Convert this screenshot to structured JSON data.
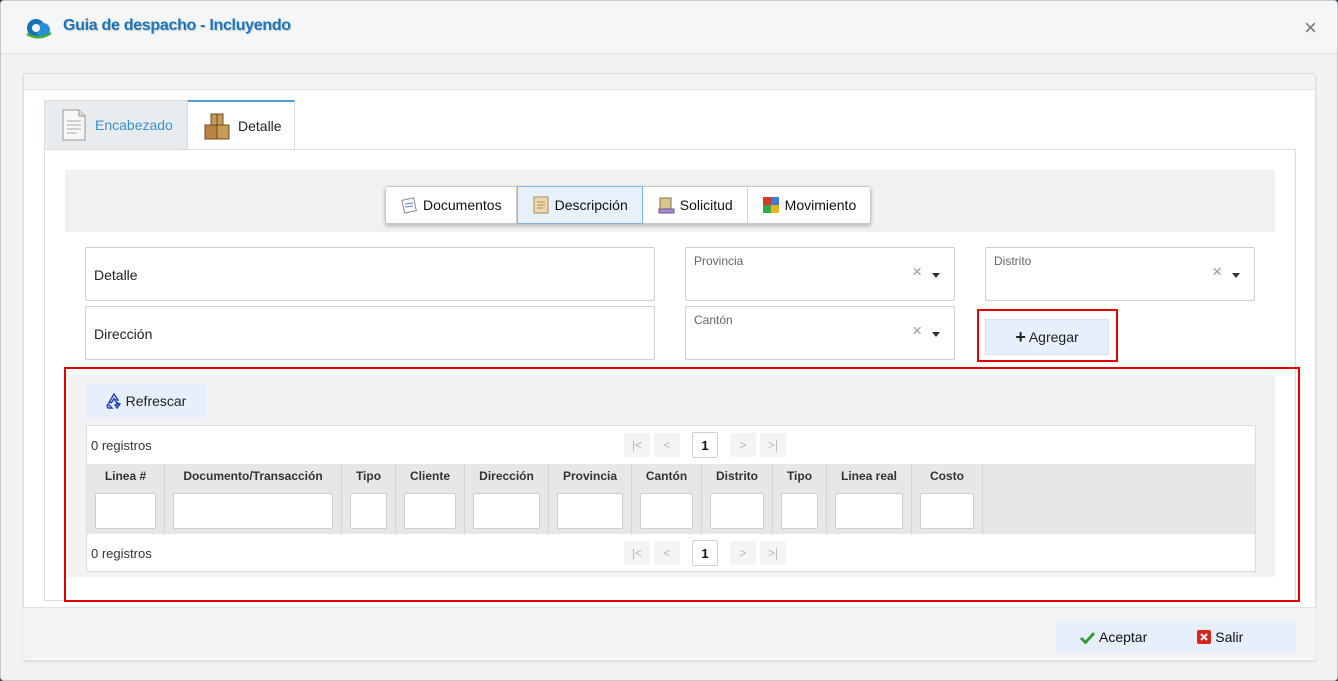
{
  "window": {
    "title": "Guia de despacho - Incluyendo",
    "close_symbol": "×"
  },
  "tabs": [
    {
      "label": "Encabezado",
      "icon": "document-icon"
    },
    {
      "label": "Detalle",
      "icon": "boxes-icon"
    }
  ],
  "subnav": [
    {
      "label": "Documentos",
      "icon": "documents-icon",
      "active": false
    },
    {
      "label": "Descripción",
      "icon": "description-icon",
      "active": true
    },
    {
      "label": "Solicitud",
      "icon": "request-icon",
      "active": false
    },
    {
      "label": "Movimiento",
      "icon": "movement-icon",
      "active": false
    }
  ],
  "form": {
    "detalle_placeholder": "Detalle",
    "direccion_placeholder": "Dirección",
    "provincia_label": "Provincia",
    "canton_label": "Cantón",
    "distrito_label": "Distrito",
    "clear_symbol": "×",
    "agregar_label": "Agregar"
  },
  "grid": {
    "refresh_label": "Refrescar",
    "records_text": "0 registros",
    "current_page": "1",
    "columns": [
      "Linea #",
      "Documento/Transacción",
      "Tipo",
      "Cliente",
      "Dirección",
      "Provincia",
      "Cantón",
      "Distrito",
      "Tipo",
      "Linea real",
      "Costo"
    ]
  },
  "footer": {
    "accept_label": "Aceptar",
    "exit_label": "Salir"
  },
  "colors": {
    "title": "#1c74b8",
    "accent_blue": "#4a9fd8",
    "highlight_red": "#e00000",
    "button_bg": "#e6effb",
    "accept_green": "#2e9b2e",
    "exit_red": "#d9241c"
  }
}
